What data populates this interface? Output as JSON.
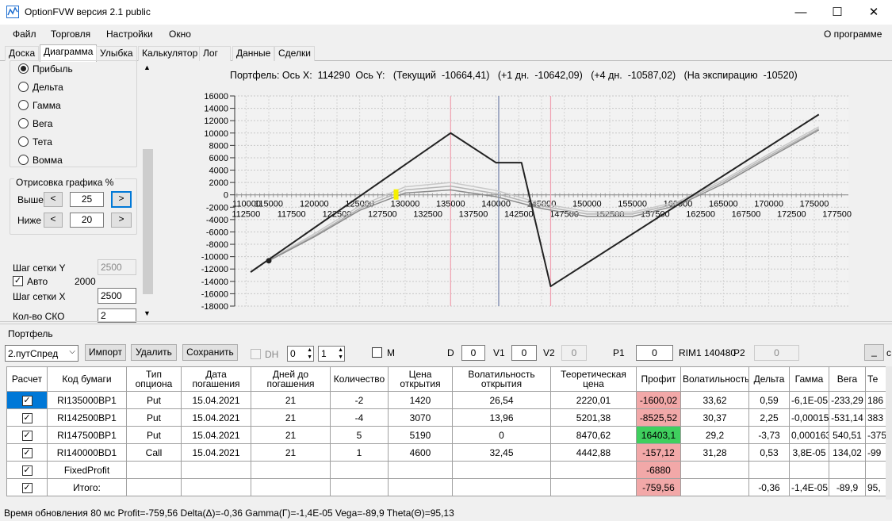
{
  "window": {
    "title": "OptionFVW версия 2.1 public",
    "minimize": "—",
    "maximize": "☐",
    "close": "✕"
  },
  "menu": {
    "items": [
      "Файл",
      "Торговля",
      "Настройки",
      "Окно"
    ],
    "about": "О программе"
  },
  "tabs": [
    "Доска",
    "Диаграмма",
    "Улыбка",
    "Калькулятор",
    "Лог",
    "Данные",
    "Сделки"
  ],
  "left": {
    "radios": [
      "Прибыль",
      "Дельта",
      "Гамма",
      "Вега",
      "Тета",
      "Вомма"
    ],
    "selected": "Прибыль",
    "draw_group": "Отрисовка графика %",
    "above_label": "Выше",
    "above_value": "25",
    "below_label": "Ниже",
    "below_value": "20",
    "prev": "<",
    "next": ">",
    "grid_y_label": "Шаг сетки Y",
    "grid_y_value": "2500",
    "auto_label": "Авто",
    "auto_value": "2000",
    "grid_x_label": "Шаг сетки X",
    "grid_x_value": "2500",
    "sko_label": "Кол-во СКО",
    "sko_value": "2"
  },
  "chart_header": "Портфель: Ось X:  114290  Ось Y:   (Текущий  -10664,41)   (+1 дн.  -10642,09)   (+4 дн.  -10587,02)   (На экспирацию  -10520)",
  "chart_data": {
    "type": "line",
    "ylim": [
      -18000,
      16000
    ],
    "xlim": [
      111250,
      178750
    ],
    "y_ticks": [
      16000,
      14000,
      12000,
      10000,
      8000,
      6000,
      4000,
      2000,
      0,
      -2000,
      -4000,
      -6000,
      -8000,
      -10000,
      -12000,
      -14000,
      -16000,
      -18000
    ],
    "x_ticks_upper": [
      110000,
      115000,
      120000,
      125000,
      130000,
      135000,
      140000,
      145000,
      150000,
      155000,
      160000,
      165000,
      170000,
      175000
    ],
    "x_ticks_lower": [
      112500,
      117500,
      122500,
      127500,
      132500,
      137500,
      142500,
      147500,
      152500,
      157500,
      162500,
      167500,
      172500,
      177500
    ],
    "vlines": [
      {
        "x": 135000,
        "color": "#f0a0b0"
      },
      {
        "x": 140290,
        "color": "#7080a8"
      },
      {
        "x": 146000,
        "color": "#f0a0b0"
      }
    ],
    "series": [
      {
        "role": "expiration",
        "color": "#222222",
        "x": [
          113000,
          135000,
          140000,
          142800,
          146000,
          175500
        ],
        "y": [
          -12500,
          10000,
          5200,
          5200,
          -14800,
          13000
        ]
      },
      {
        "role": "current",
        "color": "#8c8c8c",
        "x": [
          115000,
          120000,
          125000,
          130000,
          135000,
          140000,
          145000,
          150000,
          155000,
          160000,
          165000,
          170000,
          175500
        ],
        "y": [
          -10664,
          -6800,
          -2500,
          300,
          800,
          -300,
          -2200,
          -3500,
          -3500,
          -1700,
          1800,
          6000,
          10500
        ]
      },
      {
        "role": "day1",
        "color": "#b4b4b4",
        "x": [
          115000,
          120000,
          125000,
          130000,
          135000,
          140000,
          145000,
          150000,
          155000,
          160000,
          165000,
          170000,
          175500
        ],
        "y": [
          -10642,
          -6600,
          -2200,
          800,
          1400,
          200,
          -1800,
          -3100,
          -3100,
          -1400,
          2100,
          6300,
          10700
        ]
      },
      {
        "role": "day4",
        "color": "#c8c8c8",
        "x": [
          115000,
          120000,
          125000,
          130000,
          135000,
          140000,
          145000,
          150000,
          155000,
          160000,
          165000,
          170000,
          175500
        ],
        "y": [
          -10587,
          -6300,
          -1800,
          1300,
          2000,
          700,
          -1400,
          -2700,
          -2800,
          -1100,
          2400,
          6600,
          11000
        ]
      }
    ],
    "marker": {
      "x": 115000,
      "y": -10664,
      "color": "#222222"
    },
    "highlight": {
      "x": 129000,
      "y": 0,
      "color": "#f5f000"
    }
  },
  "portfolio": {
    "label": "Портфель",
    "combo": "2.путСпред",
    "import": "Импорт",
    "delete": "Удалить",
    "save": "Сохранить",
    "dh": "DH",
    "dh_a": "0",
    "dh_b": "1",
    "m": "M",
    "d_label": "D",
    "d_value": "0",
    "v1_label": "V1",
    "v1_value": "0",
    "v2_label": "V2",
    "v2_value": "0",
    "p1_label": "P1",
    "p1_value": "0",
    "rim": "RIM1 140480",
    "p2_label": "P2",
    "p2_value": "0",
    "min_btn": "_",
    "extra": "c"
  },
  "table": {
    "headers": [
      "Расчет",
      "Код бумаги",
      "Тип опциона",
      "Дата погашения",
      "Дней до погашения",
      "Количество",
      "Цена открытия",
      "Волатильность открытия",
      "Теоретическая цена",
      "Профит",
      "Волатильность",
      "Дельта",
      "Гамма",
      "Вега",
      "Те"
    ],
    "rows": [
      {
        "code": "RI135000BP1",
        "type": "Put",
        "date": "15.04.2021",
        "days": "21",
        "qty": "-2",
        "open": "1420",
        "volopen": "26,54",
        "theo": "2220,01",
        "profit": "-1600,02",
        "vol": "33,62",
        "delta": "0,59",
        "gamma": "-6,1E-05",
        "vega": "-233,29",
        "theta": "186"
      },
      {
        "code": "RI142500BP1",
        "type": "Put",
        "date": "15.04.2021",
        "days": "21",
        "qty": "-4",
        "open": "3070",
        "volopen": "13,96",
        "theo": "5201,38",
        "profit": "-8525,52",
        "vol": "30,37",
        "delta": "2,25",
        "gamma": "-0,000154",
        "vega": "-531,14",
        "theta": "383"
      },
      {
        "code": "RI147500BP1",
        "type": "Put",
        "date": "15.04.2021",
        "days": "21",
        "qty": "5",
        "open": "5190",
        "volopen": "0",
        "theo": "8470,62",
        "profit": "16403,1",
        "vol": "29,2",
        "delta": "-3,73",
        "gamma": "0,000163",
        "vega": "540,51",
        "theta": "-375"
      },
      {
        "code": "RI140000BD1",
        "type": "Call",
        "date": "15.04.2021",
        "days": "21",
        "qty": "1",
        "open": "4600",
        "volopen": "32,45",
        "theo": "4442,88",
        "profit": "-157,12",
        "vol": "31,28",
        "delta": "0,53",
        "gamma": "3,8E-05",
        "vega": "134,02",
        "theta": "-99"
      }
    ],
    "fixed": {
      "code": "FixedProfit",
      "profit": "-6880"
    },
    "total": {
      "code": "Итого:",
      "profit": "-759,56",
      "delta": "-0,36",
      "gamma": "-1,4E-05",
      "vega": "-89,9",
      "theta": "95,"
    }
  },
  "status": "Время обновления 80 мс   Profit=-759,56 Delta(Δ)=-0,36 Gamma(Γ)=-1,4E-05 Vega=-89,9 Theta(Θ)=95,13"
}
